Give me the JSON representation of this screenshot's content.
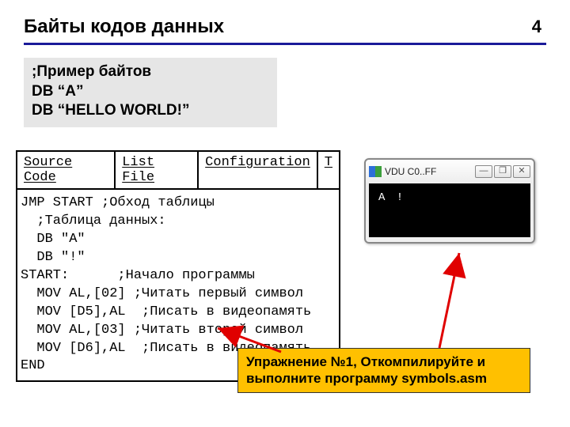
{
  "header": {
    "title": "Байты кодов данных",
    "page": "4"
  },
  "example": {
    "line1": ";Пример байтов",
    "line2": "DB “A”",
    "line3": "DB “HELLO WORLD!”"
  },
  "editor": {
    "tabs": {
      "source": "Source Code",
      "list": "List File",
      "config": "Configuration",
      "trunc": "T"
    },
    "code": "JMP START ;Обход таблицы\n  ;Таблица данных:\n  DB \"A\"\n  DB \"!\"\nSTART:      ;Начало программы\n  MOV AL,[02] ;Читать первый символ\n  MOV [D5],AL  ;Писать в видеопамять\n  MOV AL,[03] ;Читать второй символ\n  MOV [D6],AL  ;Писать в видеопамять\nEND"
  },
  "vdu": {
    "title": "VDU C0..FF",
    "buttons": {
      "min": "—",
      "max": "❐",
      "close": "✕"
    },
    "output": "A !"
  },
  "callout": {
    "text": "Упражнение №1, Откомпилируйте и выполните программу symbols.asm"
  }
}
